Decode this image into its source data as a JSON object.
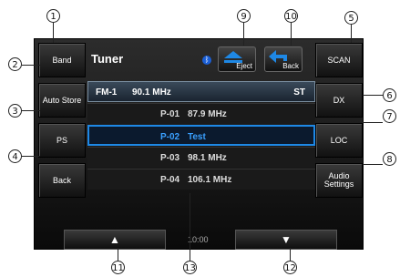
{
  "header": {
    "title": "Tuner",
    "bluetooth_icon": "bluetooth-icon"
  },
  "left_buttons": [
    "Band",
    "Auto Store",
    "PS",
    "Back"
  ],
  "right_buttons": [
    "SCAN",
    "DX",
    "LOC",
    "Audio Settings"
  ],
  "top_buttons": {
    "eject": "Eject",
    "back": "Back"
  },
  "current": {
    "band": "FM-1",
    "freq": "90.1 MHz",
    "mode": "ST"
  },
  "presets": [
    {
      "num": "P-01",
      "label": "87.9 MHz"
    },
    {
      "num": "P-02",
      "label": "Test"
    },
    {
      "num": "P-03",
      "label": "98.1 MHz"
    },
    {
      "num": "P-04",
      "label": "106.1 MHz"
    }
  ],
  "footer": {
    "clock": "10:00"
  },
  "callouts": [
    "1",
    "2",
    "3",
    "4",
    "5",
    "6",
    "7",
    "8",
    "9",
    "10",
    "11",
    "12",
    "13"
  ],
  "colors": {
    "accent": "#1e88e5",
    "screen": "#111111"
  }
}
